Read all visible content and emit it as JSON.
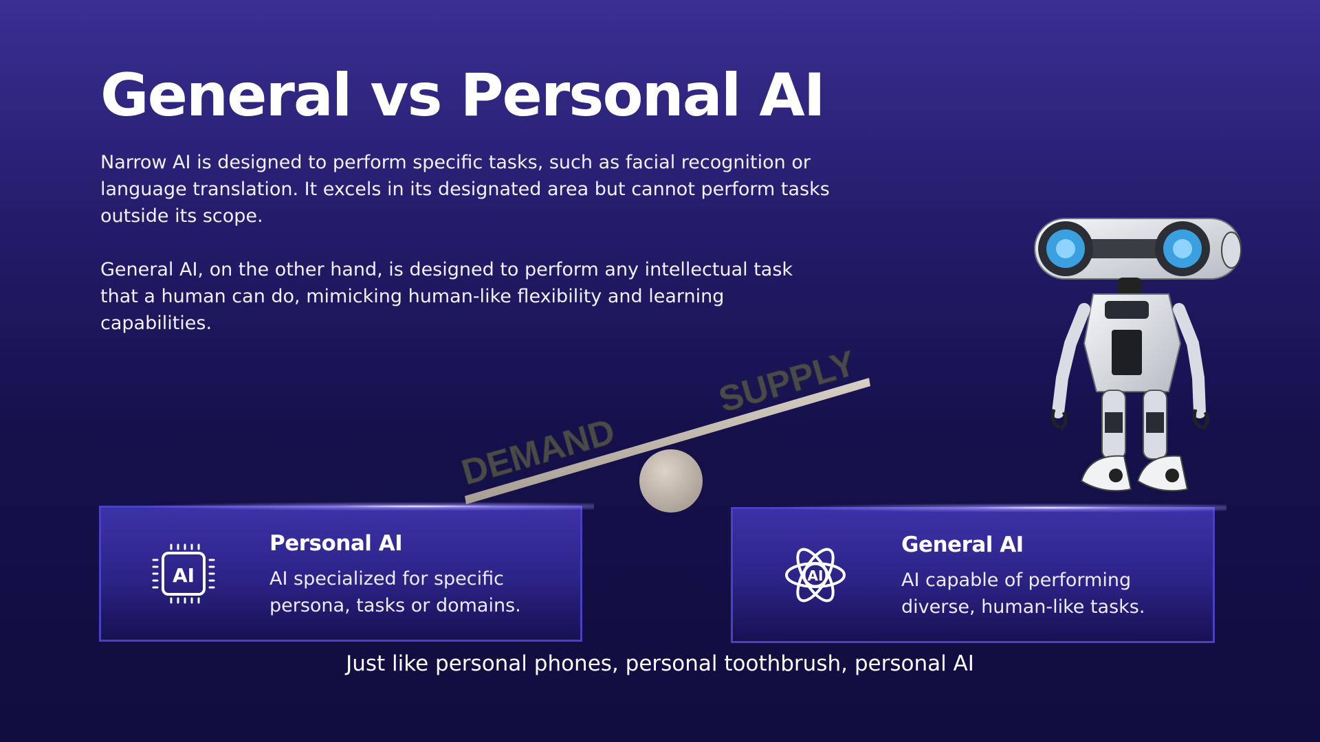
{
  "slide": {
    "title": "General vs Personal AI",
    "paragraph_1": "Narrow AI is designed to perform specific tasks, such as facial recognition or language translation. It excels in its designated area but cannot perform tasks outside its scope.",
    "paragraph_2": "General AI, on the other hand, is designed to perform any intellectual task that a human can do, mimicking human-like flexibility and learning capabilities.",
    "tagline": "Just like personal phones, personal toothbrush, personal AI"
  },
  "seesaw": {
    "left_word": "DEMAND",
    "right_word": "SUPPLY"
  },
  "cards": {
    "personal": {
      "title": "Personal AI",
      "description": "AI specialized for specific persona, tasks or domains.",
      "icon": "ai-chip-icon",
      "icon_label": "AI"
    },
    "general": {
      "title": "General AI",
      "description": "AI capable of performing diverse, human-like tasks.",
      "icon": "ai-atom-icon",
      "icon_label": "AI"
    }
  },
  "colors": {
    "background_top": "#3a2f93",
    "background_bottom": "#110d3f",
    "card_border": "#4a40c4",
    "card_fill": "#3c32a8",
    "text": "#ffffff"
  }
}
